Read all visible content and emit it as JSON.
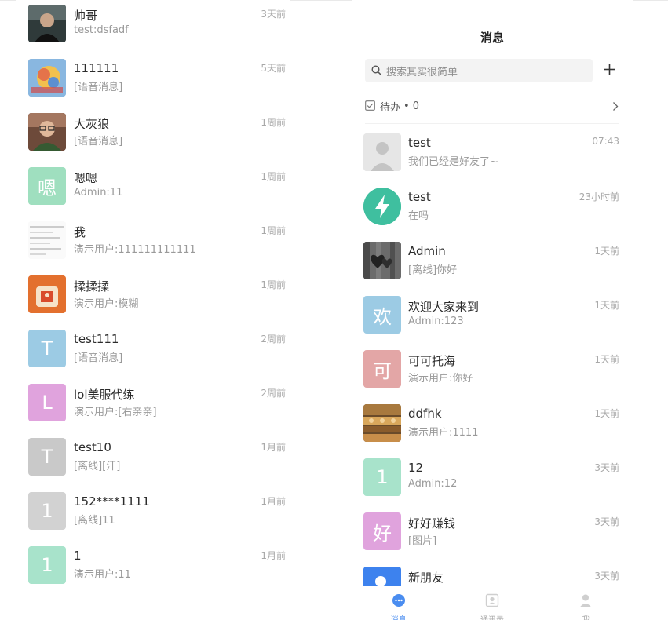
{
  "left_list": [
    {
      "name": "帅哥",
      "preview": "test:dsfadf",
      "time": "3天前",
      "avatar": {
        "type": "photo-man",
        "bg": "#3d3d3d"
      }
    },
    {
      "name": "111111",
      "preview": "[语音消息]",
      "time": "5天前",
      "avatar": {
        "type": "photo-colorful",
        "bg": "#7aa0c8"
      }
    },
    {
      "name": "大灰狼",
      "preview": "[语音消息]",
      "time": "1周前",
      "avatar": {
        "type": "photo-glasses",
        "bg": "#8a5a45"
      }
    },
    {
      "name": "嗯嗯",
      "preview": "Admin:11",
      "time": "1周前",
      "avatar": {
        "type": "letter",
        "letter": "嗯",
        "bg": "#9fdfbf"
      }
    },
    {
      "name": "我",
      "preview": "演示用户:111111111111",
      "time": "1周前",
      "avatar": {
        "type": "photo-screenshot",
        "bg": "#f4f4f4"
      }
    },
    {
      "name": "揉揉揉",
      "preview": "演示用户:模糊",
      "time": "1周前",
      "avatar": {
        "type": "photo-orange",
        "bg": "#e8743b"
      }
    },
    {
      "name": "test111",
      "preview": "[语音消息]",
      "time": "2周前",
      "avatar": {
        "type": "letter",
        "letter": "T",
        "bg": "#9ccbe4"
      }
    },
    {
      "name": "lol美服代练",
      "preview": "演示用户:[右亲亲]",
      "time": "2周前",
      "avatar": {
        "type": "letter",
        "letter": "L",
        "bg": "#e0a3dd"
      }
    },
    {
      "name": "test10",
      "preview": "[离线][汗]",
      "time": "1月前",
      "avatar": {
        "type": "letter",
        "letter": "T",
        "bg": "#c9c9c9"
      }
    },
    {
      "name": "152****1111",
      "preview": "[离线]11",
      "time": "1月前",
      "avatar": {
        "type": "letter",
        "letter": "1",
        "bg": "#d2d2d2"
      }
    },
    {
      "name": "1",
      "preview": "演示用户:11",
      "time": "1月前",
      "avatar": {
        "type": "letter",
        "letter": "1",
        "bg": "#a8e3cb"
      }
    }
  ],
  "right": {
    "title": "消息",
    "search_placeholder": "搜索其实很简单",
    "todo": {
      "label": "待办",
      "dot": "•",
      "count": "0"
    },
    "list": [
      {
        "name": "test",
        "preview": "我们已经是好友了~",
        "time": "07:43",
        "avatar": {
          "type": "default-user",
          "bg": "#e6e6e6"
        }
      },
      {
        "name": "test",
        "preview": "在吗",
        "time": "23小时前",
        "avatar": {
          "type": "bolt",
          "bg": "#3fbf9f"
        }
      },
      {
        "name": "Admin",
        "preview": "[离线]你好",
        "time": "1天前",
        "avatar": {
          "type": "photo-hearts",
          "bg": "#555555"
        }
      },
      {
        "name": "欢迎大家来到",
        "preview": "Admin:123",
        "time": "1天前",
        "avatar": {
          "type": "letter",
          "letter": "欢",
          "bg": "#9ccbe4"
        }
      },
      {
        "name": "可可托海",
        "preview": "演示用户:你好",
        "time": "1天前",
        "avatar": {
          "type": "letter",
          "letter": "可",
          "bg": "#e3a6a6"
        }
      },
      {
        "name": "ddfhk",
        "preview": "演示用户:1111",
        "time": "1天前",
        "avatar": {
          "type": "photo-market",
          "bg": "#8a6a3b"
        }
      },
      {
        "name": "12",
        "preview": "Admin:12",
        "time": "3天前",
        "avatar": {
          "type": "letter",
          "letter": "1",
          "bg": "#a8e3cb"
        }
      },
      {
        "name": "好好赚钱",
        "preview": "[图片]",
        "time": "3天前",
        "avatar": {
          "type": "letter",
          "letter": "好",
          "bg": "#e0a3dd"
        }
      },
      {
        "name": "新朋友",
        "preview": "",
        "time": "3天前",
        "avatar": {
          "type": "new-friend",
          "bg": "#3d82ee"
        }
      }
    ],
    "tabs": [
      {
        "label": "消息",
        "icon": "chat-bubble-icon",
        "active": true
      },
      {
        "label": "通讯录",
        "icon": "contacts-icon",
        "active": false
      },
      {
        "label": "我",
        "icon": "person-icon",
        "active": false
      }
    ]
  },
  "colors": {
    "accent": "#4a8df0",
    "muted": "#9a9a9a"
  }
}
